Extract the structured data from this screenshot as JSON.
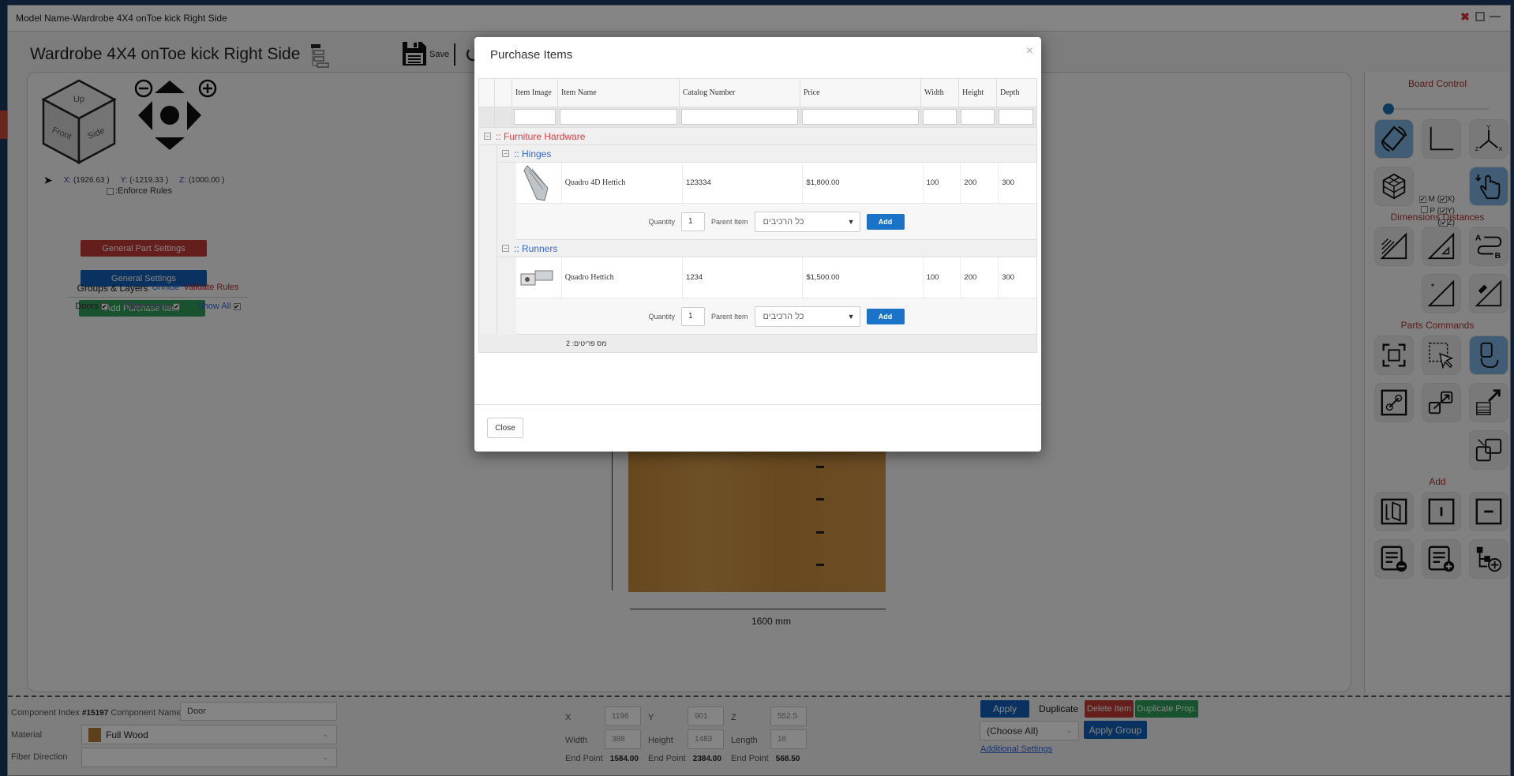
{
  "window": {
    "title": "Model Name-Wardrobe 4X4 onToe kick Right Side"
  },
  "app": {
    "title": "Wardrobe 4X4 onToe kick Right Side",
    "save_label": "Save"
  },
  "view": {
    "cube": {
      "up": "Up",
      "front": "Front",
      "side": "Side"
    },
    "coords": {
      "x_label": "X:",
      "x": "(1926.63 )",
      "y_label": "Y:",
      "y": "(-1219.33 )",
      "z_label": "Z:",
      "z": "(1000.00 )"
    },
    "enforce_rules": ":Enforce Rules"
  },
  "left_buttons": {
    "general_part_settings": "General Part Settings",
    "general_settings": "General Settings",
    "add_purchase_item": "Add Purchase Item"
  },
  "groups": {
    "title": "Groups & Layers",
    "unhide": "Unhide",
    "validate": "Validate Rules",
    "doors": "Doors",
    "dimensions": "Dimensions",
    "show_all": "Show All"
  },
  "canvas": {
    "dimension_label": "1600 mm"
  },
  "right_panel": {
    "board_control": "Board Control",
    "dimensions_distances": "Dimensions Distances",
    "parts_commands": "Parts Commands",
    "add": "Add",
    "checks": {
      "m": "M (",
      "mx": "X)",
      "p": "P (",
      "py": "Y)",
      "pz_open": "(",
      "pz": "Z)"
    }
  },
  "bottom": {
    "component_index_label": "Component Index",
    "component_index": "#15197",
    "component_name_label": "Component Name",
    "component_name": "Door",
    "material_label": "Material",
    "material": "Full Wood",
    "fiber_label": "Fiber Direction",
    "fiber": "",
    "x_label": "X",
    "x": "1196",
    "y_label": "Y",
    "y": "901",
    "z_label": "Z",
    "z": "552.5",
    "width_label": "Width",
    "width": "388",
    "height_label": "Height",
    "height": "1483",
    "length_label": "Length",
    "length": "16",
    "end_label": "End Point",
    "end_x": "1584.00",
    "end_y": "2384.00",
    "end_z": "568.50",
    "apply": "Apply",
    "duplicate": "Duplicate",
    "delete_item": "Delete Item",
    "duplicate_prop": "Duplicate Prop.",
    "choose_all": "(Choose All)",
    "apply_group": "Apply Group",
    "additional_settings": "Additional Settings"
  },
  "modal": {
    "title": "Purchase Items",
    "close_x": "×",
    "columns": [
      "Item Image",
      "Item Name",
      "Catalog Number",
      "Price",
      "Width",
      "Height",
      "Depth"
    ],
    "category": ":: Furniture Hardware",
    "groups": [
      {
        "name": ":: Hinges",
        "item": {
          "name": "Quadro 4D Hettich",
          "catalog": "123334",
          "price": "$1,800.00",
          "width": "100",
          "height": "200",
          "depth": "300"
        },
        "quantity_label": "Quantity",
        "quantity": "1",
        "parent_label": "Parent Item",
        "parent": "כל הרכיבים",
        "add": "Add"
      },
      {
        "name": ":: Runners",
        "item": {
          "name": "Quadro Hettich",
          "catalog": "1234",
          "price": "$1,500.00",
          "width": "100",
          "height": "200",
          "depth": "300"
        },
        "quantity_label": "Quantity",
        "quantity": "1",
        "parent_label": "Parent Item",
        "parent": "כל הרכיבים",
        "add": "Add"
      }
    ],
    "count_label": "מס פריטים: 2",
    "close_button": "Close"
  }
}
